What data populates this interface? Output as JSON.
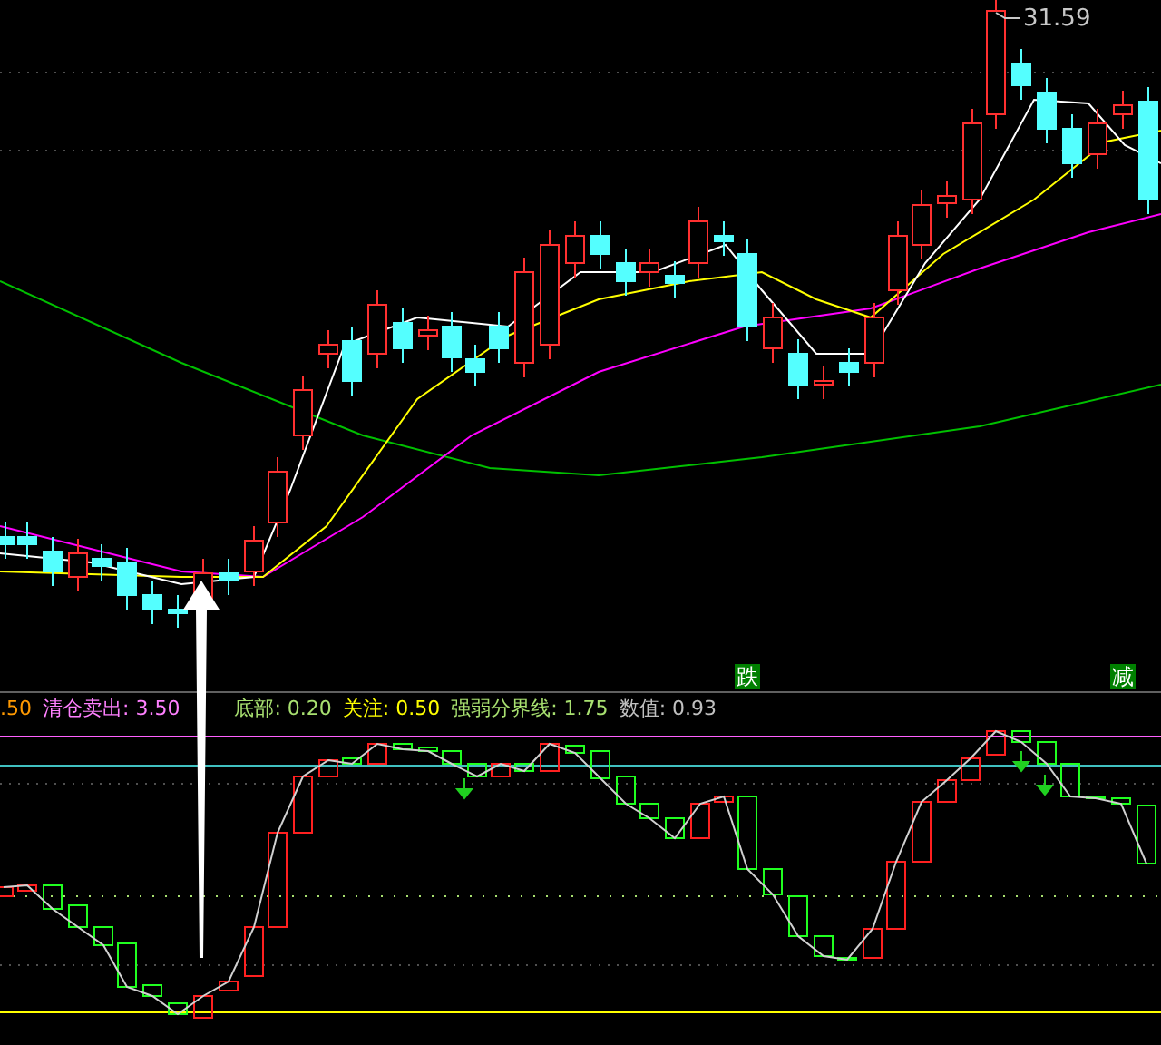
{
  "price_chart": {
    "price_label": "31.59",
    "signal_tags": [
      {
        "label": "跌"
      },
      {
        "label": "减"
      }
    ]
  },
  "indicator": {
    "legend": [
      {
        "text": ".50",
        "color": "#ff9900"
      },
      {
        "text": "清仓卖出: 3.50",
        "color": "#ff80ff"
      },
      {
        "text": "底部: 0.20",
        "color": "#a8e070"
      },
      {
        "text": "关注: 0.50",
        "color": "#ffff00"
      },
      {
        "text": "强弱分界线: 1.75",
        "color": "#a8e070"
      },
      {
        "text": "数值: 0.93",
        "color": "#c0c0c0"
      }
    ]
  }
}
